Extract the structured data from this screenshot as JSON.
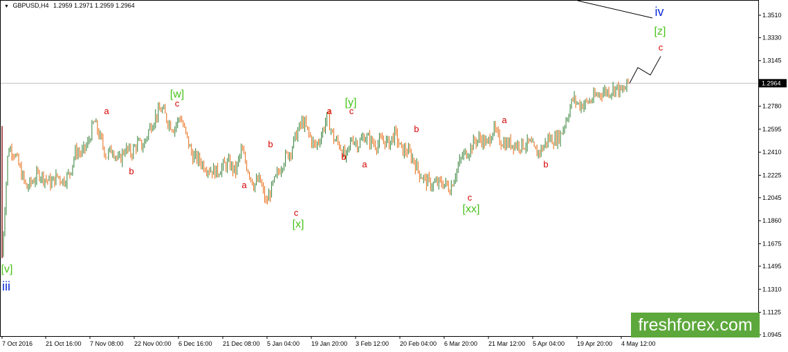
{
  "header": {
    "symbol": "GBPUSD,H4",
    "ohlc": "1.2959 1.2971 1.2959 1.2964"
  },
  "brand": {
    "text": "freshforex.com",
    "color": "#5da83c"
  },
  "colors": {
    "bull": "#2e7d32",
    "bear": "#e8660c",
    "label_red": "#d60000",
    "label_green": "#49c21c",
    "label_blue": "#0a2bd6",
    "price_line": "#c0c0c0"
  },
  "chart_data": {
    "type": "line",
    "title": "GBPUSD,H4",
    "y_range": [
      1.0945,
      1.36
    ],
    "y_ticks": [
      "1.3510",
      "1.3330",
      "1.3145",
      "1.2964",
      "1.2780",
      "1.2595",
      "1.2410",
      "1.2225",
      "1.2045",
      "1.1860",
      "1.1675",
      "1.1495",
      "1.1310",
      "1.1125",
      "1.0945"
    ],
    "current_price": "1.2964",
    "x_ticks": [
      "7 Oct 2016",
      "21 Oct 16:00",
      "7 Nov 08:00",
      "22 Nov 00:00",
      "6 Dec 16:00",
      "21 Dec 08:00",
      "5 Jan 04:00",
      "19 Jan 20:00",
      "3 Feb 12:00",
      "20 Feb 04:00",
      "6 Mar 20:00",
      "21 Mar 12:00",
      "5 Apr 04:00",
      "19 Apr 20:00",
      "4 May 12:00"
    ],
    "series": [
      {
        "values": [
          1.159,
          1.245,
          1.241,
          1.226,
          1.212,
          1.218,
          1.224,
          1.22,
          1.216,
          1.222,
          1.218,
          1.224,
          1.242,
          1.24,
          1.248,
          1.266,
          1.252,
          1.238,
          1.244,
          1.233,
          1.244,
          1.24,
          1.248,
          1.246,
          1.26,
          1.27,
          1.276,
          1.266,
          1.26,
          1.27,
          1.254,
          1.238,
          1.235,
          1.23,
          1.227,
          1.225,
          1.23,
          1.232,
          1.225,
          1.243,
          1.228,
          1.215,
          1.219,
          1.2,
          1.213,
          1.225,
          1.236,
          1.242,
          1.256,
          1.266,
          1.255,
          1.245,
          1.255,
          1.27,
          1.252,
          1.247,
          1.235,
          1.253,
          1.247,
          1.254,
          1.25,
          1.247,
          1.251,
          1.248,
          1.256,
          1.243,
          1.242,
          1.235,
          1.224,
          1.218,
          1.215,
          1.216,
          1.216,
          1.212,
          1.226,
          1.238,
          1.242,
          1.25,
          1.252,
          1.247,
          1.26,
          1.251,
          1.248,
          1.248,
          1.247,
          1.247,
          1.248,
          1.24,
          1.244,
          1.252,
          1.251,
          1.255,
          1.269,
          1.284,
          1.279,
          1.28,
          1.283,
          1.287,
          1.29,
          1.29,
          1.293,
          1.289,
          1.2964
        ]
      }
    ],
    "projection": [
      1.2964,
      1.309,
      1.303,
      1.318
    ],
    "trendline": {
      "from": [
        1.36
      ],
      "to": [
        1.351
      ]
    },
    "wave_labels": [
      {
        "text": "a",
        "color": "red"
      },
      {
        "text": "b",
        "color": "red"
      },
      {
        "text": "[w]",
        "color": "green"
      },
      {
        "text": "c",
        "color": "red"
      },
      {
        "text": "b",
        "color": "red"
      },
      {
        "text": "a",
        "color": "red"
      },
      {
        "text": "c",
        "color": "red"
      },
      {
        "text": "[x]",
        "color": "green"
      },
      {
        "text": "a",
        "color": "red"
      },
      {
        "text": "b",
        "color": "red"
      },
      {
        "text": "[y]",
        "color": "green"
      },
      {
        "text": "c",
        "color": "red"
      },
      {
        "text": "a",
        "color": "red"
      },
      {
        "text": "b",
        "color": "red"
      },
      {
        "text": "c",
        "color": "red"
      },
      {
        "text": "[xx]",
        "color": "green"
      },
      {
        "text": "a",
        "color": "red"
      },
      {
        "text": "b",
        "color": "red"
      },
      {
        "text": "iv",
        "color": "blue"
      },
      {
        "text": "[z]",
        "color": "green"
      },
      {
        "text": "c",
        "color": "red"
      },
      {
        "text": "[v]",
        "color": "green"
      },
      {
        "text": "iii",
        "color": "blue"
      }
    ]
  }
}
